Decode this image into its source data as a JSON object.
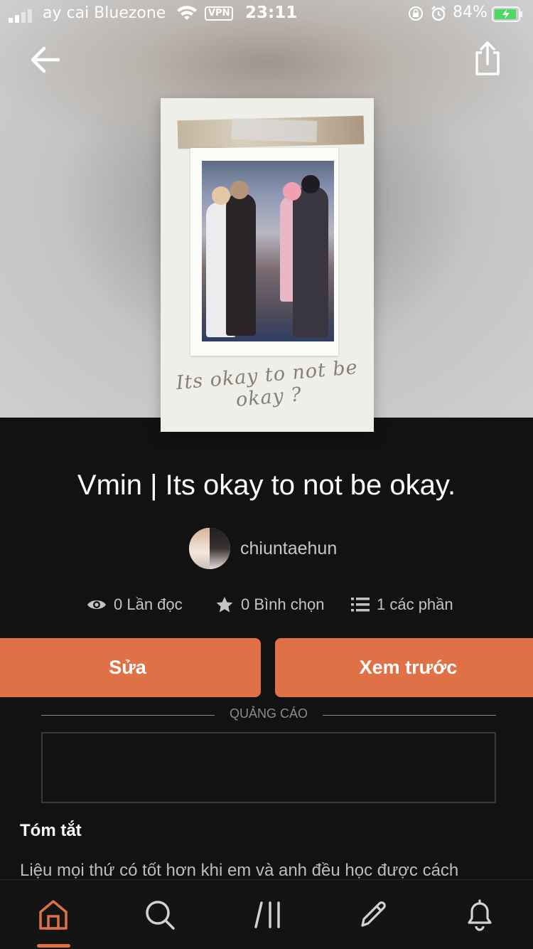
{
  "status_bar": {
    "carrier": "ay cai Bluezone",
    "vpn": "VPN",
    "time": "23:11",
    "battery": "84%"
  },
  "story": {
    "cover_text": "Its okay to not be okay ?",
    "title": "Vmin | Its okay to not be okay.",
    "author": "chiuntaehun"
  },
  "stats": {
    "reads": "0 Lần đọc",
    "votes": "0 Bình chọn",
    "parts": "1 các phần"
  },
  "actions": {
    "edit": "Sửa",
    "preview": "Xem trước"
  },
  "ad": {
    "label": "QUẢNG CÁO"
  },
  "summary": {
    "heading": "Tóm tắt",
    "text": "Liệu mọi thứ có tốt hơn khi em và anh đều học được cách"
  },
  "tabbar": {
    "items": [
      "home-icon",
      "search-icon",
      "library-icon",
      "write-icon",
      "notifications-icon"
    ],
    "active": "home-icon",
    "accent": "#e07045"
  },
  "colors": {
    "accent": "#e07045",
    "background": "#121212"
  }
}
